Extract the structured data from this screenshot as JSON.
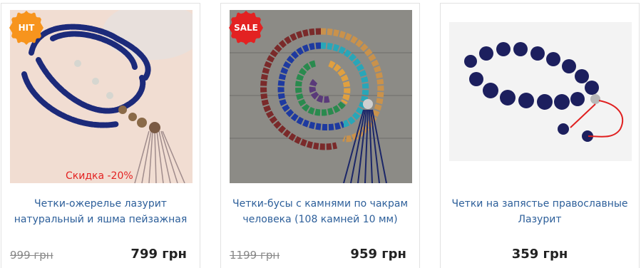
{
  "products": [
    {
      "badge": "HIT",
      "discount": "Скидка -20%",
      "title": "Четки-ожерелье лазурит натуральный и яшма пейзажная",
      "old_price": "999 грн",
      "price": "799 грн"
    },
    {
      "badge": "SALE",
      "title": "Четки-бусы с камнями по чакрам человека (108 камней 10 мм)",
      "old_price": "1199 грн",
      "price": "959 грн"
    },
    {
      "title": "Четки на запястье православные Лазурит",
      "price": "359 грн"
    }
  ],
  "colors": {
    "hit_badge": "#f7941d",
    "sale_badge": "#e32222",
    "title_link": "#2d5f9a",
    "discount": "#e32222"
  }
}
